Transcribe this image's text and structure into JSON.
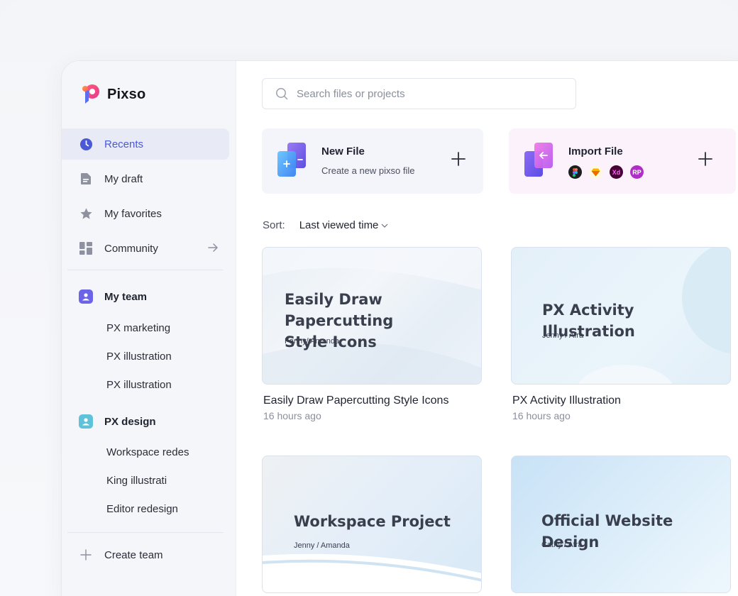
{
  "brand": {
    "name": "Pixso"
  },
  "nav": [
    {
      "label": "Recents",
      "icon": "clock-icon",
      "active": true
    },
    {
      "label": "My draft",
      "icon": "document-icon"
    },
    {
      "label": "My favorites",
      "icon": "star-icon"
    },
    {
      "label": "Community",
      "icon": "grid-icon"
    }
  ],
  "teams": [
    {
      "name": "My team",
      "items": [
        "PX marketing",
        "PX illustration",
        "PX illustration"
      ]
    },
    {
      "name": "PX design",
      "items": [
        "Workspace redes",
        "King illustrati",
        "Editor redesign"
      ]
    }
  ],
  "create_team": {
    "label": "Create team"
  },
  "search": {
    "placeholder": "Search files or projects"
  },
  "actions": {
    "new_file": {
      "title": "New File",
      "subtitle": "Create a new pixso file"
    },
    "import_file": {
      "title": "Import File",
      "tools": [
        "figma",
        "sketch",
        "Xd",
        "RP"
      ]
    }
  },
  "sort": {
    "label": "Sort:",
    "value": "Last viewed time"
  },
  "files": [
    {
      "thumb_title_line1": "Easily Draw Papercutting",
      "thumb_title_line2": "Style Icons",
      "thumb_author": "Fanny/ Amanda",
      "name": "Easily Draw Papercutting Style Icons",
      "time": "16  hours ago"
    },
    {
      "thumb_title_line1": "PX Activity Illustration",
      "thumb_title_line2": "",
      "thumb_author": "Jenny / Afra",
      "name": "PX Activity Illustration",
      "time": "16  hours ago"
    },
    {
      "thumb_title_line1": "Workspace Project",
      "thumb_title_line2": "",
      "thumb_author": "Jenny / Amanda",
      "name": "",
      "time": ""
    },
    {
      "thumb_title_line1": "Official Website Design",
      "thumb_title_line2": "",
      "thumb_author": "Cathy / Afra",
      "name": "",
      "time": ""
    }
  ],
  "colors": {
    "accent": "#4a59d6",
    "active_bg": "#e8eaf6",
    "team_purple": "#6b63e8",
    "team_teal": "#5ec3d8"
  }
}
